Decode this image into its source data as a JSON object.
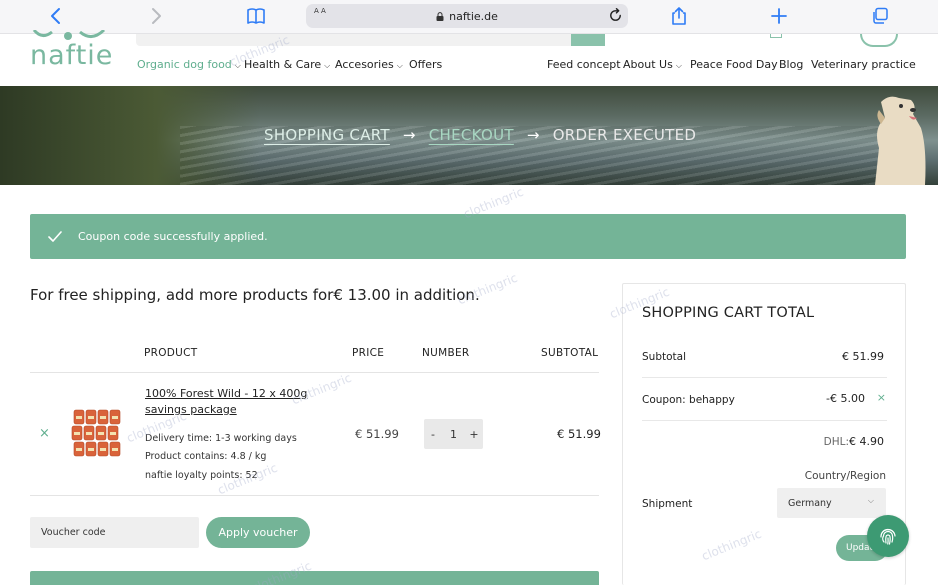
{
  "browser": {
    "url": "naftie.de",
    "text_size_label": "A A"
  },
  "site": {
    "logo_text": "naftie"
  },
  "nav": {
    "organic_dog_food": "Organic dog food",
    "health_care": "Health & Care",
    "accessories": "Accesories",
    "offers": "Offers",
    "feed_concept": "Feed concept",
    "about_us": "About Us",
    "peace_food_day": "Peace Food Day",
    "blog": "Blog",
    "veterinary_practice": "Veterinary practice"
  },
  "steps": {
    "shopping_cart": "SHOPPING CART",
    "arrow": "→",
    "checkout": "CHECKOUT",
    "order_executed": "ORDER EXECUTED"
  },
  "notice": {
    "text": "Coupon code successfully applied."
  },
  "free_shipping": {
    "text": "For free shipping, add more products for€ 13.00 in addition."
  },
  "cart": {
    "headers": {
      "product": "PRODUCT",
      "price": "PRICE",
      "number": "NUMBER",
      "subtotal": "SUBTOTAL"
    },
    "items": [
      {
        "remove": "×",
        "name": "100% Forest Wild - 12 x 400g savings package",
        "delivery_time": "Delivery time: 1-3 working days",
        "contents": "Product contains: 4.8 / kg",
        "loyalty": "naftie loyalty points: 52",
        "price": "€ 51.99",
        "quantity": "1",
        "minus": "-",
        "plus": "+",
        "subtotal": "€ 51.99"
      }
    ],
    "voucher_placeholder": "Voucher code",
    "apply_voucher": "Apply voucher"
  },
  "totals": {
    "title": "SHOPPING CART TOTAL",
    "subtotal_label": "Subtotal",
    "subtotal_value": "€ 51.99",
    "coupon_label": "Coupon: behappy",
    "coupon_value": "-€ 5.00",
    "coupon_remove": "×",
    "dhl_label": "DHL:",
    "dhl_value": "€ 4.90",
    "country_label": "Country/Region",
    "shipment_label": "Shipment",
    "country_selected": "Germany",
    "update_label": "Update"
  },
  "watermark": {
    "text": "clothingric"
  },
  "colors": {
    "brand_green": "#74b497",
    "link_blue": "#2f7cf6"
  }
}
